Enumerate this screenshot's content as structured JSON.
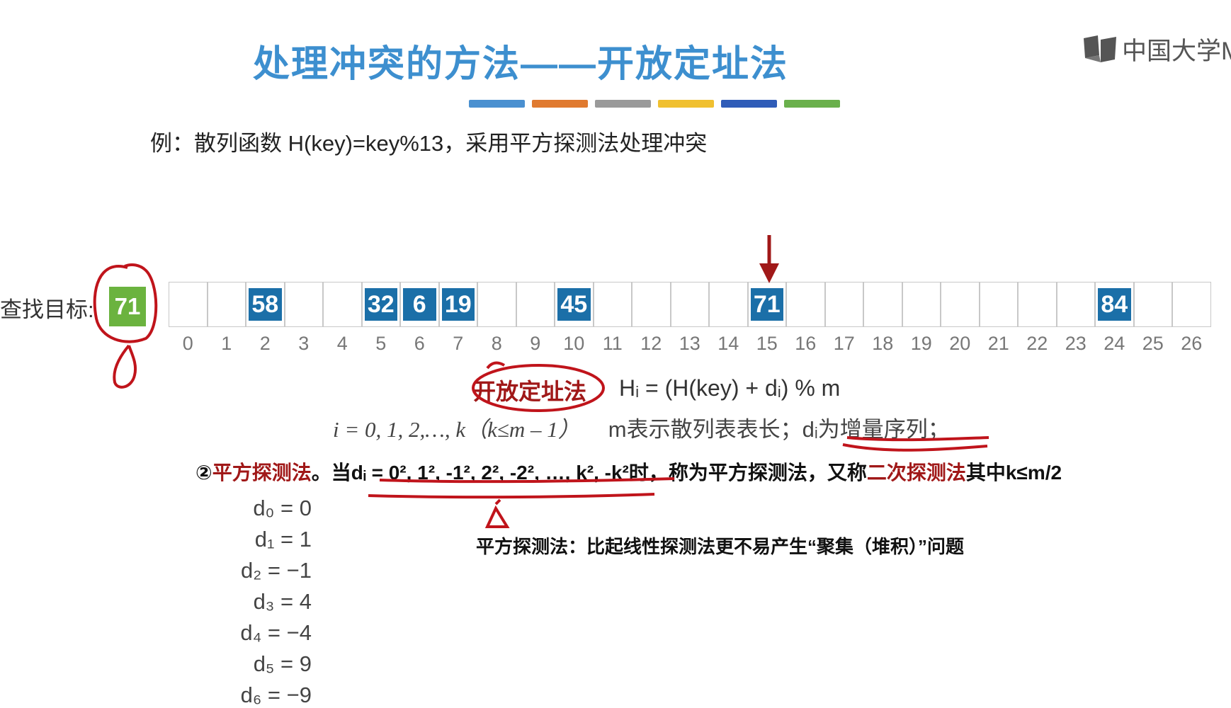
{
  "title": "处理冲突的方法——开放定址法",
  "colors": {
    "title": "#3d8fcf",
    "cell_fill": "#1b6fa8",
    "target_fill": "#6bb33f",
    "annotation_red": "#c0141b",
    "keyword_red": "#a01818"
  },
  "color_bars": [
    "#4a90d0",
    "#e07a30",
    "#9a9a9a",
    "#f0c030",
    "#2f5cb8",
    "#6ab04c"
  ],
  "logo": {
    "text": "中国大学M",
    "icon": "book-logo-icon"
  },
  "example": "例：散列函数 H(key)=key%13，采用平方探测法处理冲突",
  "search": {
    "label": "查找目标:",
    "value": "71"
  },
  "table": {
    "indices": [
      "0",
      "1",
      "2",
      "3",
      "4",
      "5",
      "6",
      "7",
      "8",
      "9",
      "10",
      "11",
      "12",
      "13",
      "14",
      "15",
      "16",
      "17",
      "18",
      "19",
      "20",
      "21",
      "22",
      "23",
      "24",
      "25",
      "26"
    ],
    "values": [
      "",
      "",
      "58",
      "",
      "",
      "32",
      "6",
      "19",
      "",
      "",
      "45",
      "",
      "",
      "",
      "",
      "71",
      "",
      "",
      "",
      "",
      "",
      "",
      "",
      "",
      "84",
      "",
      ""
    ],
    "pointer_index": 15
  },
  "formula": {
    "label": "开放定址法",
    "equation": "Hᵢ = (H(key) + dᵢ) % m",
    "range": "i = 0, 1, 2,…, k（k≤m – 1）",
    "m_desc": "m表示散列表表长；",
    "d_desc": "dᵢ为增量序列；"
  },
  "quad": {
    "prefix": "②",
    "name": "平方探测法",
    "when": "。当",
    "seq": "dᵢ = 0², 1², -1², 2², -2², …, k², -k²",
    "mid": "时，称为平方探测法，又称",
    "alt_name": "二次探测法",
    "suffix": "其中k≤m/2"
  },
  "note": "平方探测法：比起线性探测法更不易产生“聚集（堆积）”问题",
  "d_sequence": [
    "d₀ = 0",
    "d₁ = 1",
    "d₂ = −1",
    "d₃ = 4",
    "d₄ = −4",
    "d₅ = 9",
    "d₆ = −9"
  ]
}
